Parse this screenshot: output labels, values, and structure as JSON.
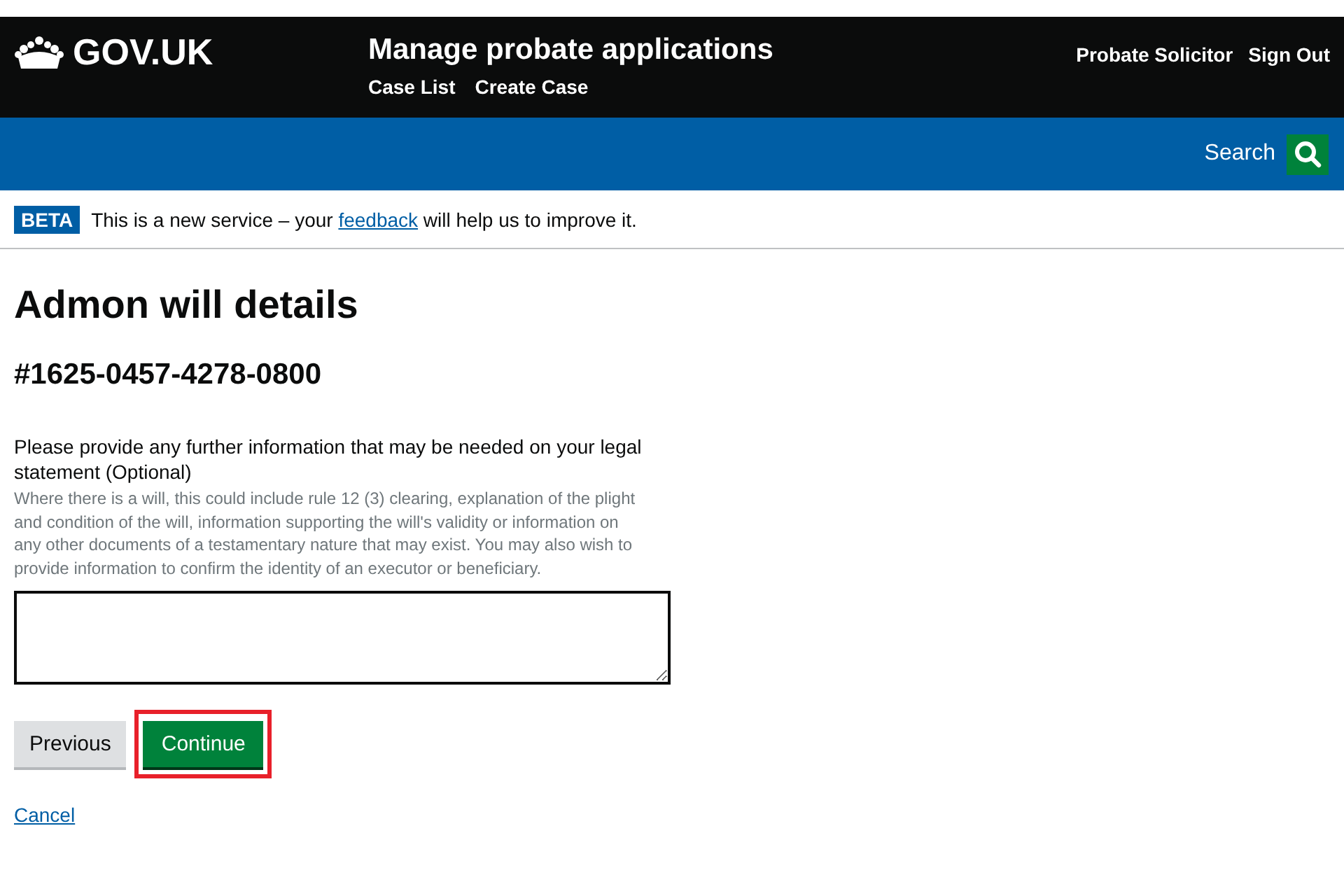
{
  "header": {
    "logo": "GOV.UK",
    "service_name": "Manage probate applications",
    "nav": [
      "Case List",
      "Create Case"
    ],
    "user": "Probate Solicitor",
    "sign_out": "Sign Out"
  },
  "search": {
    "label": "Search"
  },
  "phase_banner": {
    "tag": "BETA",
    "text_before": "This is a new service – your ",
    "link": "feedback",
    "text_after": " will help us to improve it."
  },
  "page": {
    "title": "Admon will details",
    "case_number": "#1625-0457-4278-0800"
  },
  "field": {
    "label": "Please provide any further information that may be needed on your legal statement (Optional)",
    "hint": "Where there is a will, this could include rule 12 (3) clearing, explanation of the plight and condition of the will, information supporting the will's validity or information on any other documents of a testamentary nature that may exist. You may also wish to provide information to confirm the identity of an executor or beneficiary."
  },
  "buttons": [
    {
      "label": "Previous",
      "kind": "secondary",
      "highlighted": false
    },
    {
      "label": "Continue",
      "kind": "primary",
      "highlighted": true
    }
  ],
  "cancel": "Cancel"
}
